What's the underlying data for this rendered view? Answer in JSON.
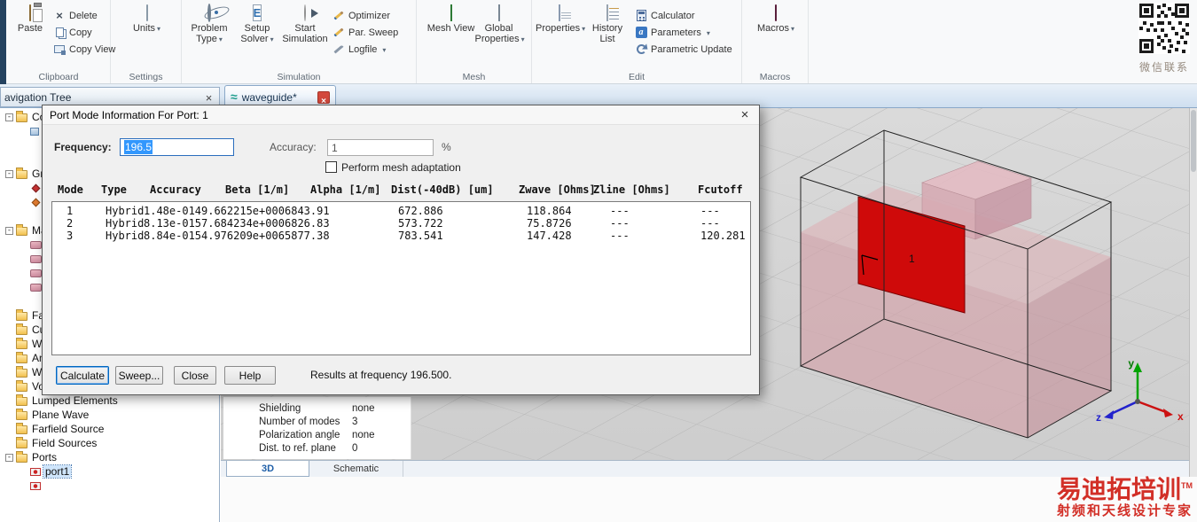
{
  "ribbon": {
    "clipboard": {
      "label": "Clipboard",
      "paste": "Paste",
      "delete": "Delete",
      "copy": "Copy",
      "copy_view": "Copy View"
    },
    "settings": {
      "label": "Settings",
      "units": "Units"
    },
    "simulation": {
      "label": "Simulation",
      "problem_type": "Problem Type",
      "setup_solver": "Setup Solver",
      "start_simulation": "Start Simulation",
      "optimizer": "Optimizer",
      "par_sweep": "Par. Sweep",
      "logfile": "Logfile"
    },
    "mesh": {
      "label": "Mesh",
      "mesh_view": "Mesh View",
      "global_properties": "Global Properties"
    },
    "edit": {
      "label": "Edit",
      "properties": "Properties",
      "history_list": "History List",
      "calculator": "Calculator",
      "parameters": "Parameters",
      "parametric_update": "Parametric Update"
    },
    "macros_group": {
      "label": "Macros",
      "macros": "Macros"
    },
    "qr_caption": "微信联系"
  },
  "tabbar": {
    "nav_panel_title": "avigation Tree",
    "document_tab": "waveguide*"
  },
  "nav_tree": {
    "items": [
      {
        "label": "Cor",
        "icon": "folder",
        "expand": "-"
      },
      {
        "label": "",
        "icon": "component",
        "cls": "ind1"
      },
      {
        "label": "",
        "icon": "none"
      },
      {
        "label": "",
        "icon": "none"
      },
      {
        "label": "Gro",
        "icon": "folder",
        "expand": "-"
      },
      {
        "label": "",
        "icon": "group-red",
        "cls": "ind1"
      },
      {
        "label": "",
        "icon": "group-orange",
        "cls": "ind1"
      },
      {
        "label": "",
        "icon": "none"
      },
      {
        "label": "Mat",
        "icon": "folder",
        "expand": "-"
      },
      {
        "label": "",
        "icon": "material",
        "cls": "ind1"
      },
      {
        "label": "",
        "icon": "material",
        "cls": "ind1"
      },
      {
        "label": "",
        "icon": "material",
        "cls": "ind1"
      },
      {
        "label": "",
        "icon": "material",
        "cls": "ind1"
      },
      {
        "label": "",
        "icon": "none"
      },
      {
        "label": "Fac",
        "icon": "folder"
      },
      {
        "label": "Cur",
        "icon": "folder"
      },
      {
        "label": "WC",
        "icon": "folder"
      },
      {
        "label": "And",
        "icon": "folder"
      },
      {
        "label": "Wir",
        "icon": "folder"
      },
      {
        "label": "Vox",
        "icon": "folder"
      },
      {
        "label": "Lumped Elements",
        "icon": "folder"
      },
      {
        "label": "Plane Wave",
        "icon": "folder"
      },
      {
        "label": "Farfield Source",
        "icon": "folder"
      },
      {
        "label": "Field Sources",
        "icon": "folder"
      },
      {
        "label": "Ports",
        "icon": "folder",
        "expand": "-"
      },
      {
        "label": "port1",
        "icon": "port",
        "cls": "ind1 selected"
      },
      {
        "label": "",
        "icon": "port",
        "cls": "ind1"
      }
    ]
  },
  "dialog": {
    "title": "Port Mode Information For Port: 1",
    "frequency_label": "Frequency:",
    "frequency_value": "196.5",
    "accuracy_label": "Accuracy:",
    "accuracy_value": "1",
    "percent": "%",
    "mesh_adaptation_label": "Perform mesh adaptation",
    "table": {
      "columns": [
        "Mode",
        "Type",
        "Accuracy",
        "Beta [1/m]",
        "Alpha [1/m]",
        "Dist(-40dB) [um]",
        "Zwave [Ohms]",
        "Zline [Ohms]",
        "Fcutoff"
      ],
      "rows": [
        [
          "1",
          "Hybrid",
          "1.48e-014",
          "9.662215e+000",
          "6843.91",
          "672.886",
          "118.864",
          "---",
          "---"
        ],
        [
          "2",
          "Hybrid",
          "8.13e-015",
          "7.684234e+000",
          "6826.83",
          "573.722",
          "75.8726",
          "---",
          "---"
        ],
        [
          "3",
          "Hybrid",
          "8.84e-015",
          "4.976209e+006",
          "5877.38",
          "783.541",
          "147.428",
          "---",
          "120.281"
        ]
      ]
    },
    "buttons": {
      "calculate": "Calculate",
      "sweep": "Sweep...",
      "close": "Close",
      "help": "Help"
    },
    "status": "Results at frequency 196.500."
  },
  "port_properties": {
    "rows": [
      {
        "label": "Shielding",
        "value": "none"
      },
      {
        "label": "Number of modes",
        "value": "3"
      },
      {
        "label": "Polarization angle",
        "value": "none"
      },
      {
        "label": "Dist. to ref. plane",
        "value": "0"
      }
    ]
  },
  "view_tabs": {
    "tab_3d": "3D",
    "tab_schematic": "Schematic"
  },
  "view3d": {
    "port_label": "1",
    "axis_x": "x",
    "axis_y": "y",
    "axis_z": "z"
  },
  "watermark": {
    "title": "易迪拓培训",
    "tm": "TM",
    "subtitle": "射频和天线设计专家"
  },
  "colors": {
    "port_red": "#cf0a0a",
    "substrate_pink": "#d2a0a8",
    "mesh_green": "#46b050",
    "watermark_red": "#d22f27",
    "selection_blue": "#3297fd"
  }
}
